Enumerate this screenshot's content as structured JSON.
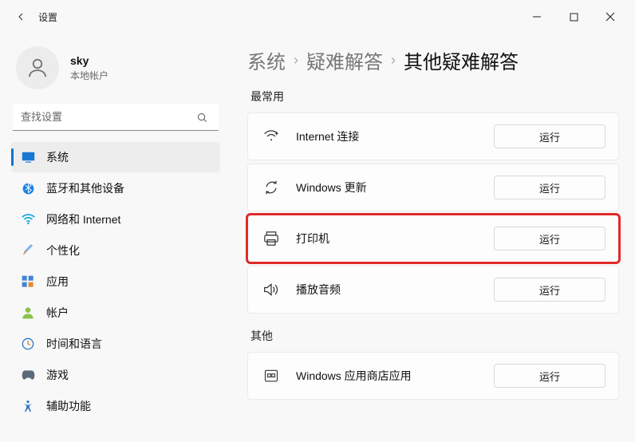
{
  "app_title": "设置",
  "user": {
    "name": "sky",
    "sub": "本地帐户"
  },
  "search": {
    "placeholder": "查找设置"
  },
  "nav": [
    {
      "label": "系统"
    },
    {
      "label": "蓝牙和其他设备"
    },
    {
      "label": "网络和 Internet"
    },
    {
      "label": "个性化"
    },
    {
      "label": "应用"
    },
    {
      "label": "帐户"
    },
    {
      "label": "时间和语言"
    },
    {
      "label": "游戏"
    },
    {
      "label": "辅助功能"
    }
  ],
  "breadcrumb": {
    "a": "系统",
    "b": "疑难解答",
    "c": "其他疑难解答"
  },
  "section_most": "最常用",
  "section_other": "其他",
  "run_label": "运行",
  "troubleshooters": [
    {
      "label": "Internet 连接"
    },
    {
      "label": "Windows 更新"
    },
    {
      "label": "打印机"
    },
    {
      "label": "播放音频"
    }
  ],
  "troubleshooters_other": [
    {
      "label": "Windows 应用商店应用"
    }
  ]
}
